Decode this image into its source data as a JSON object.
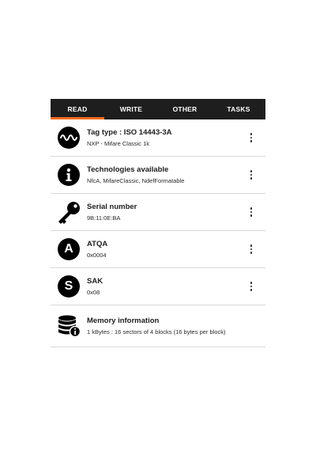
{
  "tabs": [
    {
      "label": "READ",
      "active": true
    },
    {
      "label": "WRITE",
      "active": false
    },
    {
      "label": "OTHER",
      "active": false
    },
    {
      "label": "TASKS",
      "active": false
    }
  ],
  "accent_color": "#f26b1d",
  "items": [
    {
      "icon": "wave-icon",
      "title": "Tag type : ISO 14443-3A",
      "subtitle": "NXP - Mifare Classic 1k"
    },
    {
      "icon": "info-icon",
      "title": "Technologies available",
      "subtitle": "NfcA, MifareClassic, NdefFormatable"
    },
    {
      "icon": "key-icon",
      "title": "Serial number",
      "subtitle": "9B:11:0E:BA"
    },
    {
      "icon": "letter-a-icon",
      "glyph": "A",
      "title": "ATQA",
      "subtitle": "0x0004"
    },
    {
      "icon": "letter-s-icon",
      "glyph": "S",
      "title": "SAK",
      "subtitle": "0x08"
    },
    {
      "icon": "database-info-icon",
      "title": "Memory information",
      "subtitle": "1 kBytes : 16 sectors of 4 blocks (16 bytes per block)"
    }
  ]
}
